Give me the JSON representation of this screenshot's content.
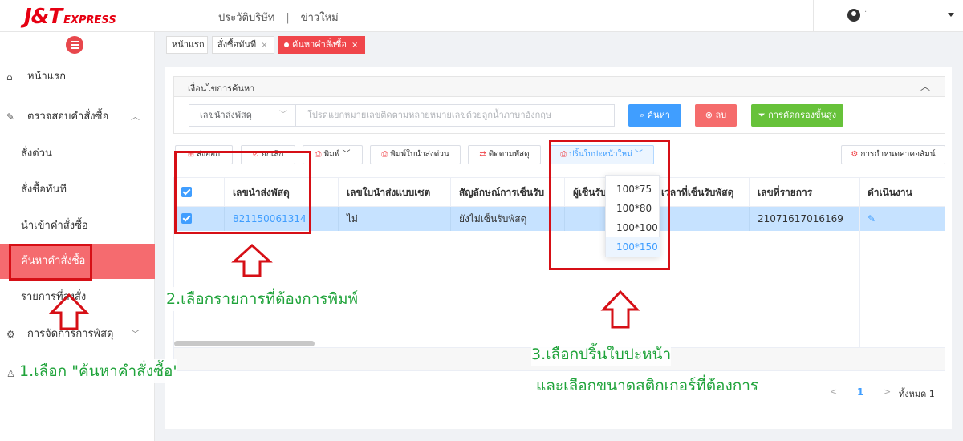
{
  "header": {
    "logo_main": "J&T",
    "logo_sub": "EXPRESS",
    "nav_company": "ประวัติบริษัท",
    "nav_sep": "|",
    "nav_news": "ข่าวใหม่",
    "user_dot": "·"
  },
  "sidebar": {
    "home": "หน้าแรก",
    "check_orders": "ตรวจสอบคำสั่งซื้อ",
    "sub": [
      "สั่งด่วน",
      "สั่งซื้อทันที",
      "นำเข้าคำสั่งซื้อ",
      "ค้นหาคำสั่งซื้อ",
      "รายการที่ลงสั่ง"
    ],
    "parcel_manage": "การจัดการการพัสดุ"
  },
  "tabs": [
    {
      "label": "หน้าแรก",
      "close": ""
    },
    {
      "label": "สั่งซื้อทันที",
      "close": "×"
    },
    {
      "label": "ค้นหาคำสั่งซื้อ",
      "close": "×"
    }
  ],
  "search": {
    "section_title": "เงื่อนไขการค้นหา",
    "type_select": "เลขนำส่งพัสดุ",
    "placeholder": "โปรดแยกหมายเลขติดตามหลายหมายเลขด้วยลูกน้ำภาษาอังกฤษ",
    "search_btn": "ค้นหา",
    "clear_btn": "ลบ",
    "filter_btn": "การคัดกรองขั้นสูง"
  },
  "toolbar": {
    "export": "ส่งออก",
    "cancel": "ยกเลิก",
    "print": "พิมพ์",
    "print_express": "พิมพ์ใบนำส่งด่วน",
    "track": "ติดตามพัสดุ",
    "print_label": "ปริ้นใบปะหน้าใหม่",
    "column_settings": "การกำหนดค่าคอลัมน์"
  },
  "table": {
    "headers": [
      "เลขนำส่งพัสดุ",
      "เลขใบนำส่งแบบเซต",
      "สัญลักษณ์การเซ็นรับ",
      "ผู้เซ็นรับ",
      "เวลาที่เซ็นรับพัสดุ",
      "เลขที่รายการ",
      "ดำเนินงาน"
    ],
    "rows": [
      {
        "tracking": "821150061314",
        "set_no": "ไม่",
        "sign_status": "ยังไม่เซ็นรับพัสดุ",
        "signer": "",
        "sign_time": "",
        "order_no": "21071617016169"
      }
    ]
  },
  "dropdown": {
    "options": [
      "100*75",
      "100*80",
      "100*100",
      "100*150"
    ],
    "selected_index": 3
  },
  "pagination": {
    "prev": "<",
    "page": "1",
    "next": ">",
    "total": "ทั้งหมด 1"
  },
  "annotations": {
    "step1": "1.เลือก \"ค้นหาคำสั่งซื้อ'",
    "step2": "2.เลือกรายการที่ต้องการพิมพ์",
    "step3_line1": "3.เลือกปริ้นใบปะหน้า",
    "step3_line2": "และเลือกขนาดสติกเกอร์ที่ต้องการ"
  },
  "colors": {
    "brand_red": "#e60012",
    "accent_blue": "#409eff",
    "annotation_green": "#1fa33a",
    "annotation_red": "#d60f16"
  }
}
